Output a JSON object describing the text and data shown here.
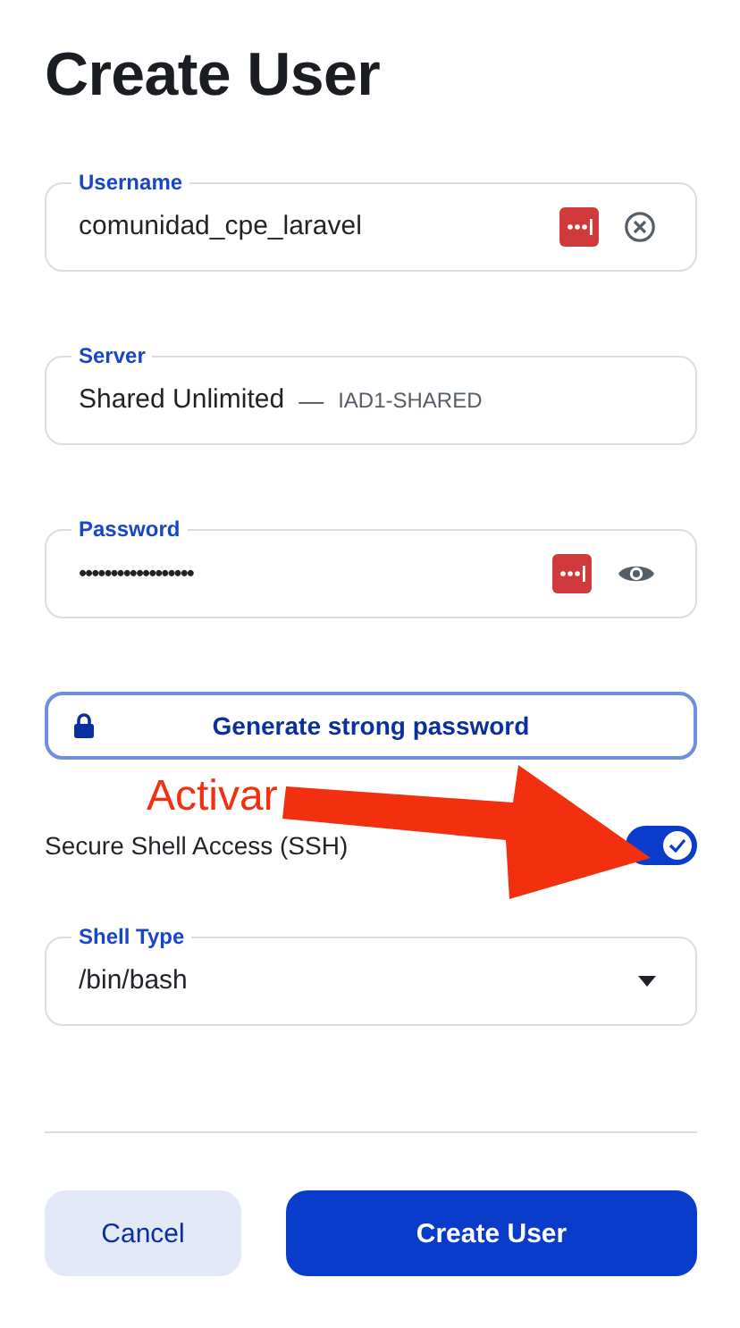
{
  "title": "Create User",
  "fields": [
    {
      "kind": "text",
      "label": "Username",
      "value": "comunidad_cpe_laravel",
      "password_manager": true,
      "clear_button": true
    },
    {
      "kind": "server",
      "label": "Server",
      "value": "Shared Unlimited",
      "separator": "—",
      "detail": "IAD1-SHARED"
    },
    {
      "kind": "password",
      "label": "Password",
      "value": "••••••••••••••••••",
      "password_manager": true,
      "reveal_button": true
    }
  ],
  "generate_button": "Generate strong password",
  "ssh": {
    "label": "Secure Shell Access (SSH)",
    "on": true
  },
  "shell": {
    "label": "Shell Type",
    "value": "/bin/bash"
  },
  "annotation": {
    "text": "Activar"
  },
  "buttons": [
    {
      "label": "Cancel",
      "kind": "secondary"
    },
    {
      "label": "Create User",
      "kind": "primary"
    }
  ]
}
